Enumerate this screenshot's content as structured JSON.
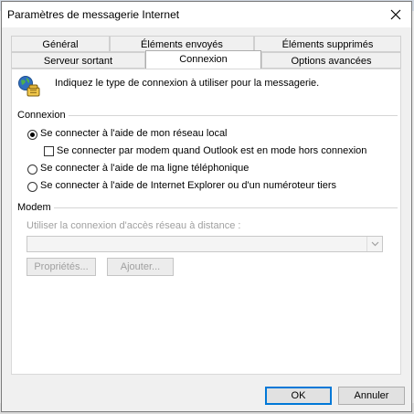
{
  "window": {
    "title": "Paramètres de messagerie Internet"
  },
  "icons": {
    "close": "close-icon",
    "connection": "globe-phone-icon",
    "dropdown": "chevron-down-icon"
  },
  "tabs_row1": [
    {
      "label": "Général"
    },
    {
      "label": "Éléments envoyés"
    },
    {
      "label": "Éléments supprimés"
    }
  ],
  "tabs_row2": [
    {
      "label": "Serveur sortant"
    },
    {
      "label": "Connexion",
      "active": true
    },
    {
      "label": "Options avancées"
    }
  ],
  "intro": "Indiquez le type de connexion à utiliser pour la messagerie.",
  "connexion": {
    "heading": "Connexion",
    "options": [
      {
        "label": "Se connecter à l'aide de mon réseau local",
        "checked": true
      },
      {
        "label": "Se connecter à l'aide de ma ligne téléphonique",
        "checked": false
      },
      {
        "label": "Se connecter à l'aide de Internet Explorer ou d'un numéroteur tiers",
        "checked": false
      }
    ],
    "offline_checkbox": {
      "label": "Se connecter par modem quand Outlook est en mode hors connexion",
      "checked": false
    }
  },
  "modem": {
    "heading": "Modem",
    "dial_label": "Utiliser la connexion d'accès réseau à distance :",
    "dial_value": "",
    "properties_button": "Propriétés...",
    "add_button": "Ajouter..."
  },
  "footer": {
    "ok": "OK",
    "cancel": "Annuler"
  }
}
